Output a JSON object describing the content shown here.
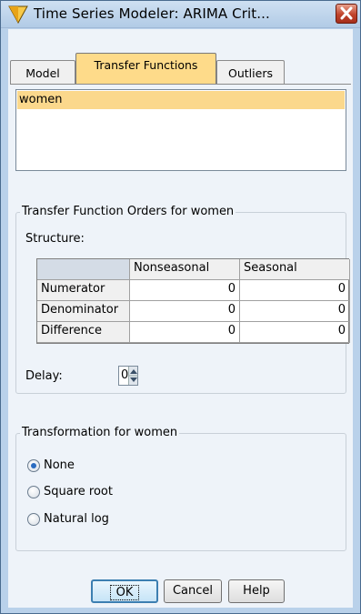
{
  "window": {
    "title": "Time Series Modeler: ARIMA Crit..."
  },
  "tabs": [
    {
      "label": "Model",
      "active": false
    },
    {
      "label": "Transfer Functions",
      "active": true
    },
    {
      "label": "Outliers",
      "active": false
    }
  ],
  "variables": {
    "items": [
      "women"
    ],
    "selected": "women"
  },
  "orders": {
    "legend": "Transfer Function Orders for women",
    "structure_label": "Structure:",
    "columns": [
      "",
      "Nonseasonal",
      "Seasonal"
    ],
    "rows": [
      {
        "label": "Numerator",
        "nonseasonal": "0",
        "seasonal": "0"
      },
      {
        "label": "Denominator",
        "nonseasonal": "0",
        "seasonal": "0"
      },
      {
        "label": "Difference",
        "nonseasonal": "0",
        "seasonal": "0"
      }
    ],
    "delay_label": "Delay:",
    "delay_value": "0"
  },
  "transformation": {
    "legend": "Transformation for women",
    "options": [
      {
        "label": "None",
        "checked": true
      },
      {
        "label": "Square root",
        "checked": false
      },
      {
        "label": "Natural log",
        "checked": false
      }
    ]
  },
  "buttons": {
    "ok": "OK",
    "cancel": "Cancel",
    "help": "Help"
  },
  "colors": {
    "active_tab": "#fedb8a",
    "selected_item": "#fbd88c",
    "title_bar": "#b9d1ea",
    "close_button": "#c0432b"
  },
  "icons": {
    "title": "diamond-app-icon",
    "close": "close-icon"
  }
}
